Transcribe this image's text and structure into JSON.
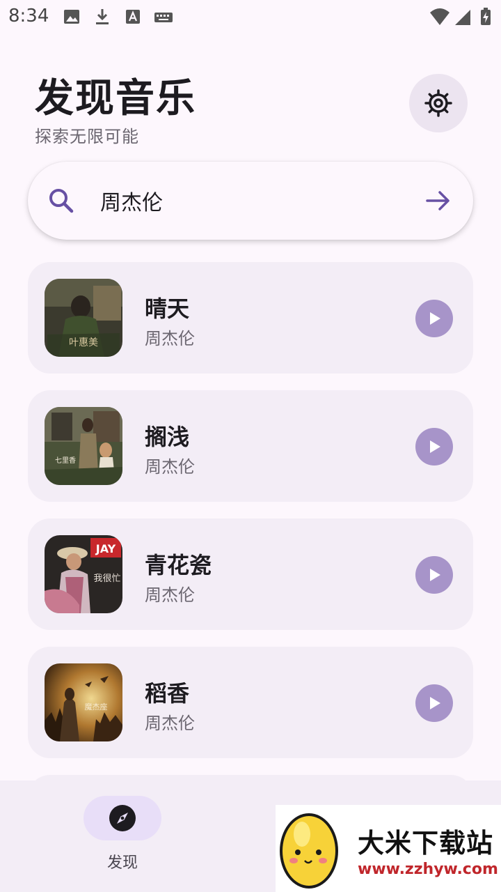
{
  "status_bar": {
    "time": "8:34",
    "left_icons": [
      "image-icon",
      "download-icon",
      "text-a-icon",
      "keyboard-icon"
    ],
    "right_icons": [
      "wifi-icon",
      "signal-icon",
      "battery-charging-icon"
    ]
  },
  "header": {
    "title": "发现音乐",
    "subtitle": "探索无限可能",
    "settings_icon": "gear-icon"
  },
  "search": {
    "value": "周杰伦",
    "placeholder": "",
    "search_icon": "search-icon",
    "submit_icon": "arrow-right-icon"
  },
  "songs": [
    {
      "title": "晴天",
      "artist": "周杰伦",
      "cover": "album-cover-1"
    },
    {
      "title": "搁浅",
      "artist": "周杰伦",
      "cover": "album-cover-2"
    },
    {
      "title": "青花瓷",
      "artist": "周杰伦",
      "cover": "album-cover-3"
    },
    {
      "title": "稻香",
      "artist": "周杰伦",
      "cover": "album-cover-4"
    }
  ],
  "bottom_nav": {
    "items": [
      {
        "label": "发现",
        "icon": "compass-icon",
        "selected": true
      }
    ]
  },
  "watermark": {
    "title": "大米下载站",
    "url": "www.zzhyw.com"
  },
  "colors": {
    "background": "#fdf7fd",
    "card": "#f3edf6",
    "accent": "#6750a4",
    "play_button": "#a794c9",
    "nav_indicator": "#e8def8"
  }
}
